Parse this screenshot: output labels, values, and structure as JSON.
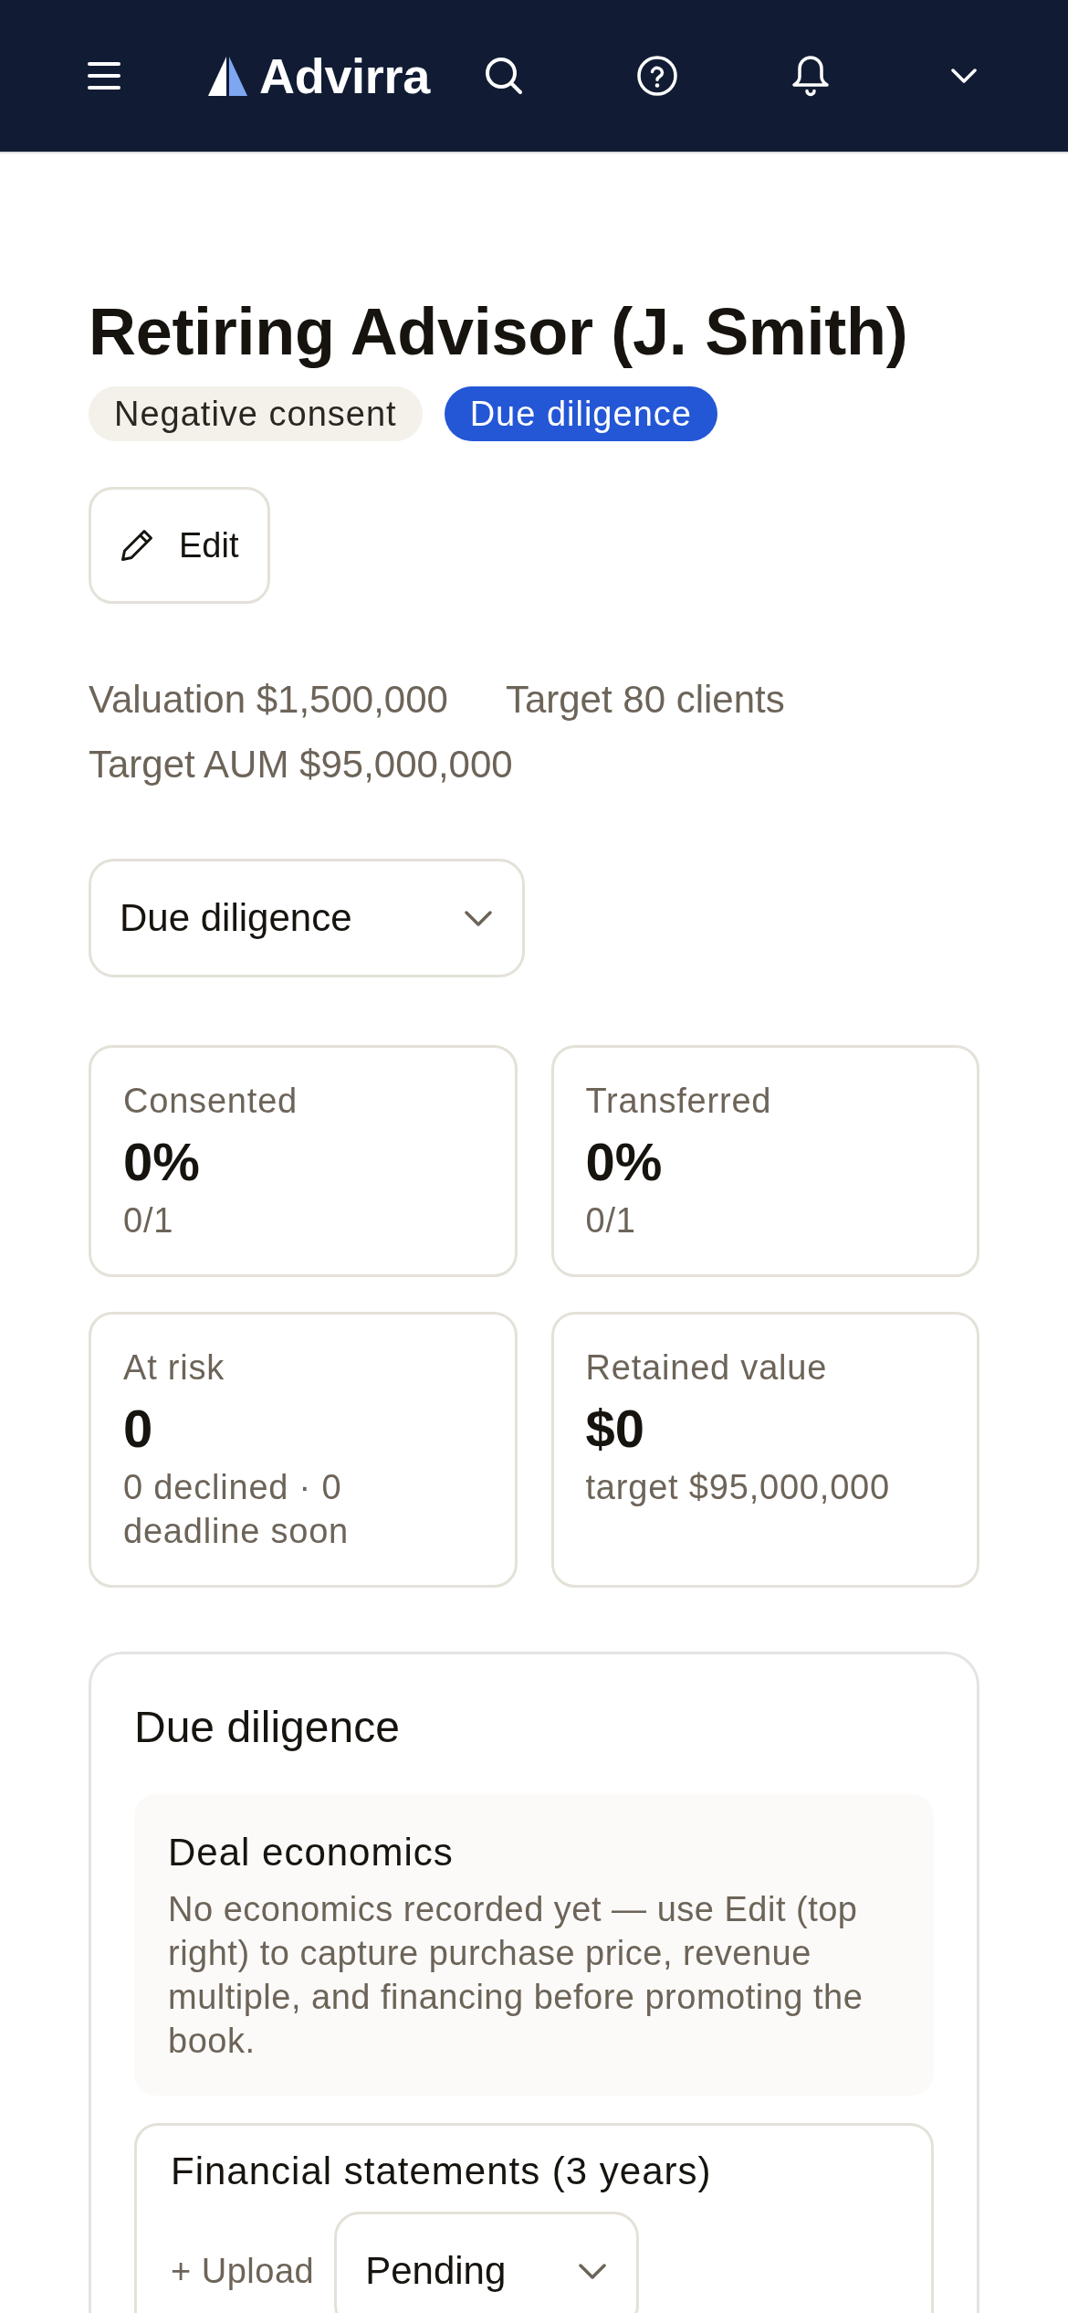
{
  "header": {
    "brand": "Advirra"
  },
  "deal": {
    "title": "Retiring Advisor (J. Smith)",
    "badges": [
      {
        "label": "Negative consent",
        "kind": "consent"
      },
      {
        "label": "Due diligence",
        "kind": "stage"
      }
    ],
    "edit_button": "Edit",
    "facts": [
      "Valuation $1,500,000",
      "Target 80 clients",
      "Target AUM $95,000,000"
    ],
    "stage_select": {
      "value": "Due diligence"
    }
  },
  "stats": [
    {
      "label": "Consented",
      "value": "0%",
      "detail": "0/1"
    },
    {
      "label": "Transferred",
      "value": "0%",
      "detail": "0/1"
    },
    {
      "label": "At risk",
      "value": "0",
      "detail": "0 declined · 0 deadline soon"
    },
    {
      "label": "Retained value",
      "value": "$0",
      "detail": "target $95,000,000"
    }
  ],
  "section": {
    "title": "Due diligence",
    "blocks": [
      {
        "kind": "note",
        "title": "Deal economics",
        "text": "No economics recorded yet — use Edit (top right) to capture purchase price, revenue multiple, and financing before promoting the book."
      },
      {
        "kind": "document",
        "title": "Financial statements (3 years)",
        "action": "+ Upload",
        "status": "Pending"
      }
    ]
  }
}
